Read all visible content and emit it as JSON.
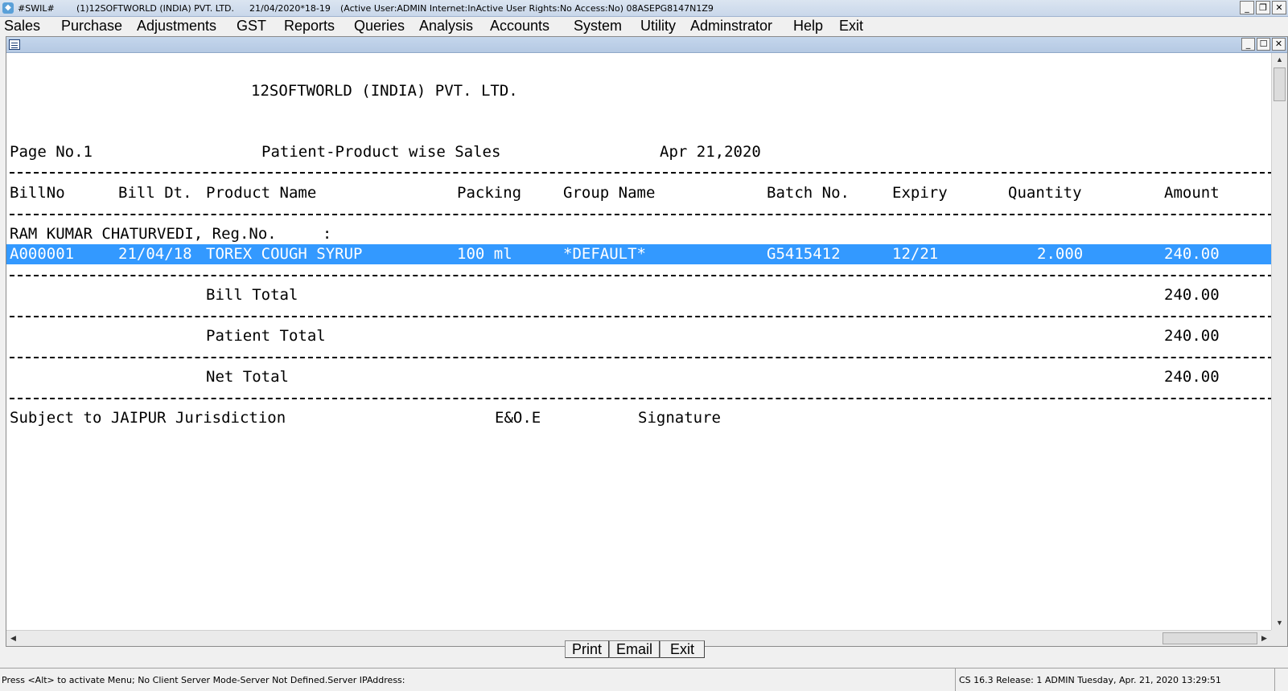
{
  "titlebar": {
    "app": "#SWIL#",
    "company": "(1)12SOFTWORLD (INDIA) PVT. LTD.",
    "date_year": "21/04/2020*18-19",
    "user_info": "(Active User:ADMIN Internet:InActive User Rights:No Access:No) 08ASEPG8147N1Z9"
  },
  "menu": [
    "Sales",
    "Purchase",
    "Adjustments",
    "GST",
    "Reports",
    "Queries",
    "Analysis",
    "Accounts",
    "System",
    "Utility",
    "Adminstrator",
    "Help",
    "Exit"
  ],
  "report": {
    "company": "12SOFTWORLD (INDIA) PVT. LTD.",
    "page_no": "Page No.1",
    "title": "Patient-Product wise Sales",
    "date": "Apr 21,2020",
    "columns": {
      "bill_no": "BillNo",
      "bill_dt": "Bill Dt.",
      "product": "Product Name",
      "packing": "Packing",
      "group": "Group Name",
      "batch": "Batch No.",
      "expiry": "Expiry",
      "quantity": "Quantity",
      "amount": "Amount"
    },
    "patient": "RAM KUMAR CHATURVEDI, Reg.No.     :",
    "row": {
      "bill_no": "A000001",
      "bill_dt": "21/04/18",
      "product": "TOREX COUGH SYRUP",
      "packing": "100 ml",
      "group": "*DEFAULT*",
      "batch": "G5415412",
      "expiry": "12/21",
      "quantity": "2.000",
      "amount": "240.00"
    },
    "bill_total_label": "Bill Total",
    "bill_total": "240.00",
    "patient_total_label": "Patient Total",
    "patient_total": "240.00",
    "net_total_label": "Net Total",
    "net_total": "240.00",
    "footer_jurisdiction": "Subject to JAIPUR Jurisdiction",
    "footer_eoe": "E&O.E",
    "footer_signature": "Signature"
  },
  "buttons": {
    "print": "Print",
    "email": "Email",
    "exit": "Exit"
  },
  "status": {
    "left": "Press <Alt> to activate Menu; No Client Server Mode-Server Not Defined.Server IPAddress:",
    "right": "CS 16.3 Release: 1  ADMIN  Tuesday, Apr. 21, 2020  13:29:51"
  },
  "colors": {
    "highlight": "#3399ff"
  }
}
